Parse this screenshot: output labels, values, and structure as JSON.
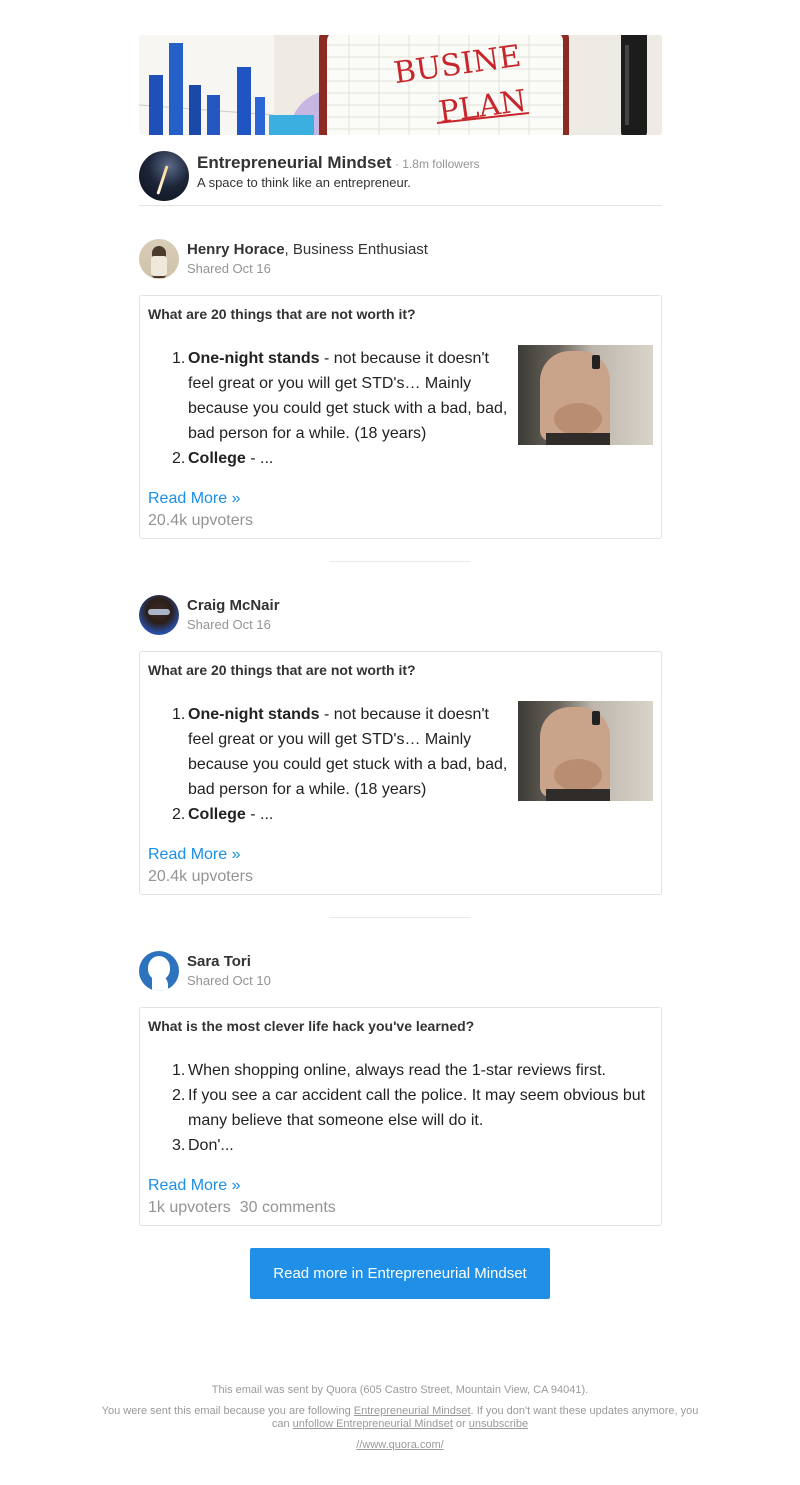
{
  "banner": {
    "image_alt": "Business plan banner",
    "image_text_line1": "BUSINE",
    "image_text_line2": "PLAN"
  },
  "space": {
    "name": "Entrepreneurial Mindset",
    "followers": " · 1.8m followers",
    "description": "A space to think like an entrepreneur."
  },
  "posts": [
    {
      "author_name": "Henry Horace",
      "author_credential": ", Business Enthusiast",
      "shared": "Shared Oct 16",
      "question": "What are 20 things that are not worth it?",
      "items": [
        {
          "num": "1.",
          "bold": "One-night stands",
          "text": " - not because it doesn't feel great or you will get STD's… Mainly because you could get stuck with a bad, bad, bad person for a while. (18 years)"
        },
        {
          "num": "2.",
          "bold": "College",
          "text": " - ..."
        }
      ],
      "read_more": "Read More »",
      "upvoters": "20.4k upvoters",
      "comments": ""
    },
    {
      "author_name": "Craig McNair",
      "author_credential": "",
      "shared": "Shared Oct 16",
      "question": "What are 20 things that are not worth it?",
      "items": [
        {
          "num": "1.",
          "bold": "One-night stands",
          "text": " - not because it doesn't feel great or you will get STD's… Mainly because you could get stuck with a bad, bad, bad person for a while. (18 years)"
        },
        {
          "num": "2.",
          "bold": "College",
          "text": " - ..."
        }
      ],
      "read_more": "Read More »",
      "upvoters": "20.4k upvoters",
      "comments": ""
    },
    {
      "author_name": "Sara Tori",
      "author_credential": "",
      "shared": "Shared Oct 10",
      "question": "What is the most clever life hack you've learned?",
      "items": [
        {
          "num": "1.",
          "bold": "",
          "text": "When shopping online, always read the 1-star reviews first."
        },
        {
          "num": "2.",
          "bold": "",
          "text": "If you see a car accident call the police. It may seem obvious but many believe that someone else will do it."
        },
        {
          "num": "3.",
          "bold": "",
          "text": "Don'..."
        }
      ],
      "read_more": "Read More »",
      "upvoters": "1k upvoters",
      "comments": "30 comments"
    }
  ],
  "cta": {
    "label": "Read more in Entrepreneurial Mindset"
  },
  "footer": {
    "sent_by": "This email was sent by Quora (605 Castro Street, Mountain View, CA 94041).",
    "reason_prefix": "You were sent this email because you are following ",
    "reason_space": "Entrepreneurial Mindset",
    "reason_mid": ". If you don't want these updates anymore, you can ",
    "unfollow": "unfollow Entrepreneurial Mindset",
    "or": " or ",
    "unsubscribe": "unsubscribe",
    "url": "//www.quora.com/"
  },
  "colors": {
    "link": "#1a8fe6",
    "cta": "#1f8fe8",
    "muted": "#949494"
  }
}
